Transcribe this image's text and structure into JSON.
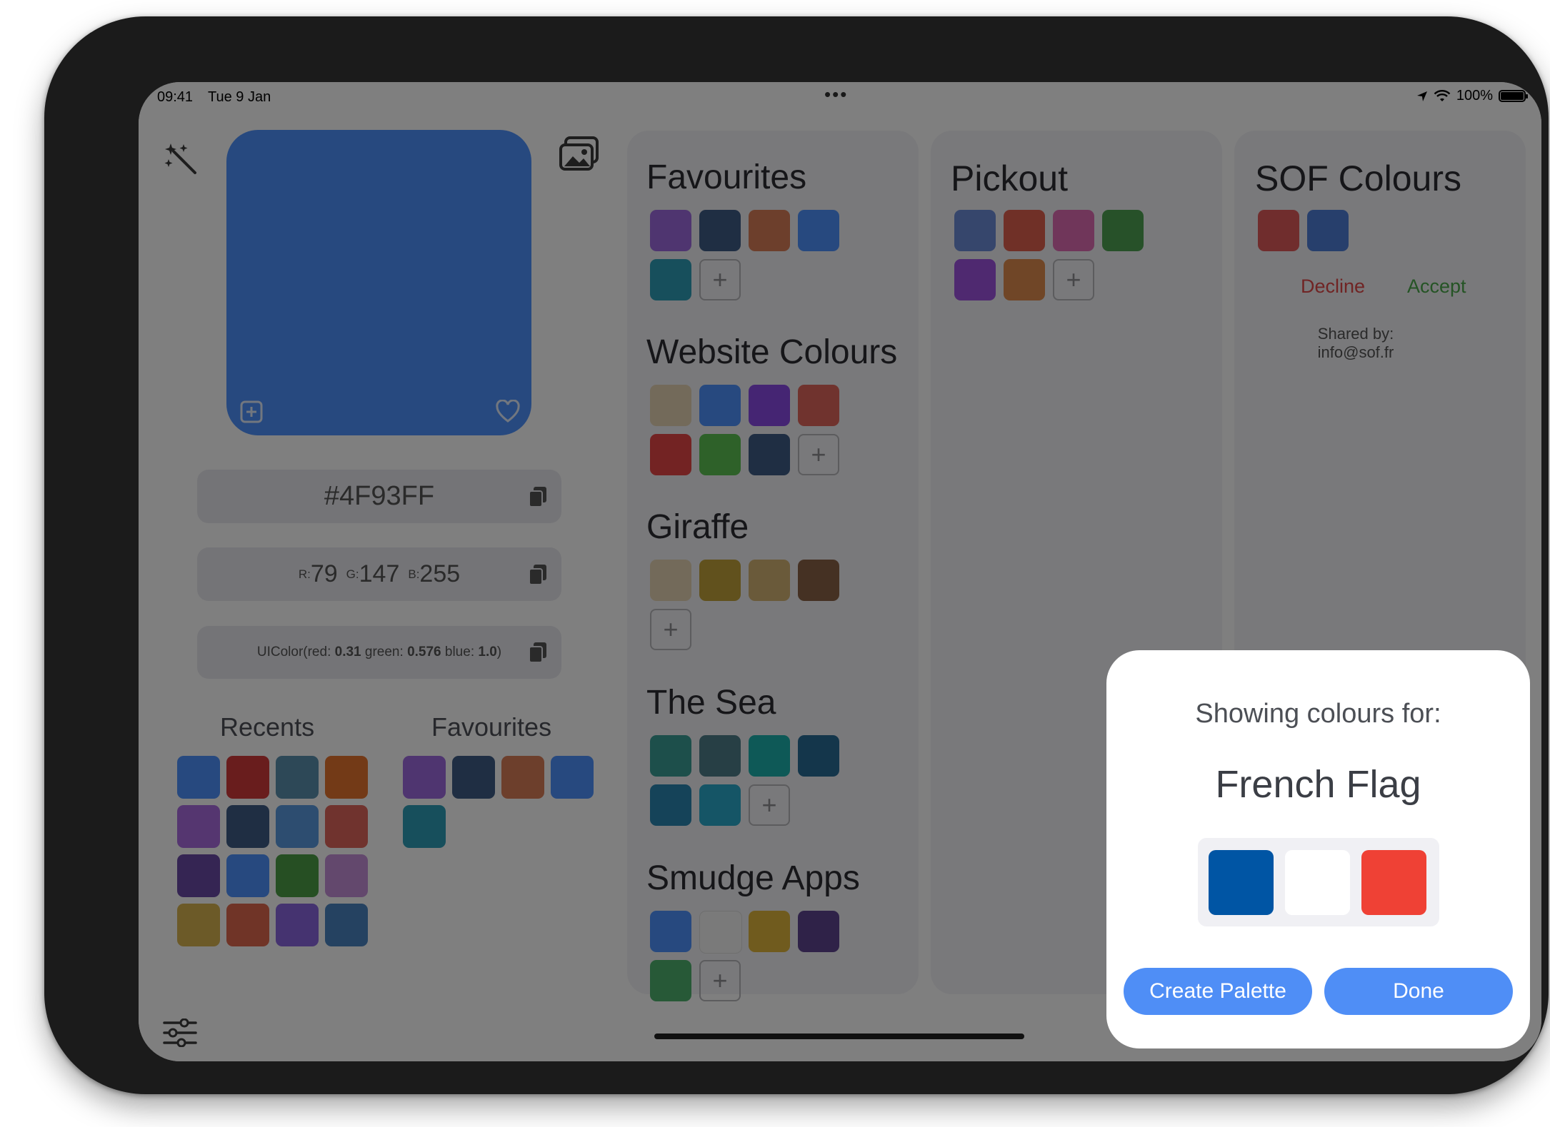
{
  "status": {
    "time": "09:41",
    "date": "Tue 9 Jan",
    "battery": "100%"
  },
  "picker": {
    "hex": "#4F93FF",
    "rgb": {
      "r_label": "R:",
      "r": "79",
      "g_label": "G:",
      "g": "147",
      "b_label": "B:",
      "b": "255"
    },
    "uicolor": {
      "prefix": "UIColor(red:",
      "red": "0.31",
      "green_label": "green:",
      "green": "0.576",
      "blue_label": "blue:",
      "blue": "1.0",
      "suffix": ")"
    },
    "preview_color": "#4F93FF"
  },
  "recents": {
    "title": "Recents",
    "colors": [
      "#4F93FF",
      "#D33A3A",
      "#5A90AE",
      "#E6742E",
      "#AB6DE0",
      "#3F5C86",
      "#5A9BE0",
      "#E0675C",
      "#6A4AA6",
      "#4F93FF",
      "#4C9E47",
      "#C791DA",
      "#D9B551",
      "#E0684E",
      "#8A66E0",
      "#4B84C2"
    ]
  },
  "favourites_small": {
    "title": "Favourites",
    "colors": [
      "#9E6BE0",
      "#3F5C86",
      "#DA7E59",
      "#4F93FF",
      "#2F9FB8"
    ]
  },
  "palettes": [
    {
      "title": "Favourites",
      "colors": [
        "#9E6BE0",
        "#3F5C86",
        "#DA7E59",
        "#4F93FF",
        "#2F9FB8"
      ]
    },
    {
      "title": "Website Colours",
      "colors": [
        "#E6D4B4",
        "#4F93FF",
        "#8A4AE6",
        "#E0675C",
        "#E64646",
        "#5CC352",
        "#3F5C86"
      ]
    },
    {
      "title": "Giraffe",
      "colors": [
        "#E6D4B4",
        "#C2A33A",
        "#D4B574",
        "#8A6246"
      ]
    },
    {
      "title": "The Sea",
      "colors": [
        "#3A9E97",
        "#4F7F8A",
        "#1CB3AF",
        "#296C97",
        "#2B87B3",
        "#2AAACC"
      ]
    },
    {
      "title": "Smudge Apps",
      "colors": [
        "#4F93FF",
        "#F4F4F4",
        "#E0B73C",
        "#5E4590",
        "#4FB36E"
      ]
    }
  ],
  "pickout": {
    "title": "Pickout",
    "colors": [
      "#6C8CD9",
      "#E0604E",
      "#E06CB5",
      "#4FA353",
      "#9E52E0",
      "#E08D4E"
    ]
  },
  "sof": {
    "title": "SOF Colours",
    "colors": [
      "#E05A5A",
      "#4F7FD9"
    ],
    "decline": "Decline",
    "accept": "Accept",
    "shared_label": "Shared by:",
    "shared_email": "info@sof.fr"
  },
  "sheet": {
    "subtitle": "Showing colours for:",
    "title": "French Flag",
    "colors": [
      "#0055A4",
      "#FFFFFF",
      "#EF4135"
    ],
    "create": "Create Palette",
    "done": "Done"
  },
  "accent": "#4F8EF6"
}
